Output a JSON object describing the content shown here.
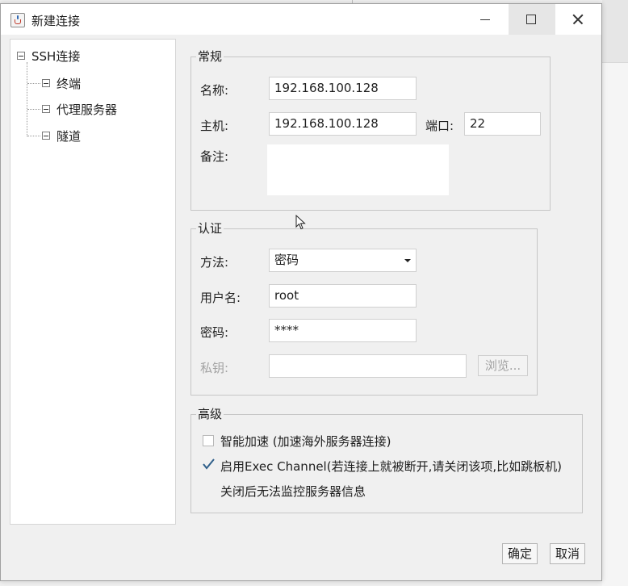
{
  "window": {
    "title": "新建连接",
    "controls": {
      "minimize": "minimize",
      "maximize": "maximize",
      "close": "close"
    }
  },
  "tree": {
    "root": "SSH连接",
    "children": [
      "终端",
      "代理服务器",
      "隧道"
    ]
  },
  "general": {
    "legend": "常规",
    "name_label": "名称:",
    "name_value": "192.168.100.128",
    "host_label": "主机:",
    "host_value": "192.168.100.128",
    "port_label": "端口:",
    "port_value": "22",
    "note_label": "备注:",
    "note_value": ""
  },
  "auth": {
    "legend": "认证",
    "method_label": "方法:",
    "method_value": "密码",
    "user_label": "用户名:",
    "user_value": "root",
    "password_label": "密码:",
    "password_value": "****",
    "key_label": "私钥:",
    "key_value": "",
    "browse_label": "浏览..."
  },
  "advanced": {
    "legend": "高级",
    "accel_label": "智能加速 (加速海外服务器连接)",
    "accel_checked": false,
    "exec_label": "启用Exec Channel(若连接上就被断开,请关闭该项,比如跳板机)",
    "exec_checked": true,
    "exec_note": "关闭后无法监控服务器信息"
  },
  "buttons": {
    "ok": "确定",
    "cancel": "取消"
  },
  "colors": {
    "check_mark": "#2f5f8a",
    "title_bar": "#ffffff",
    "window_bg": "#f0f0f0"
  }
}
